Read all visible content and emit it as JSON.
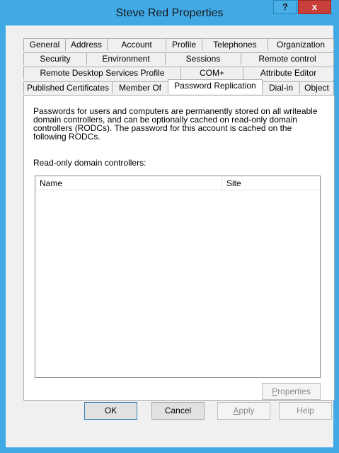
{
  "window": {
    "title": "Steve Red Properties"
  },
  "titlebar": {
    "help_glyph": "?",
    "close_glyph": "x"
  },
  "tabs": {
    "row1": [
      "General",
      "Address",
      "Account",
      "Profile",
      "Telephones",
      "Organization"
    ],
    "row2": [
      "Security",
      "Environment",
      "Sessions",
      "Remote control"
    ],
    "row3": [
      "Remote Desktop Services Profile",
      "COM+",
      "Attribute Editor"
    ],
    "row4": [
      "Published Certificates",
      "Member Of",
      "Password Replication",
      "Dial-in",
      "Object"
    ],
    "active": "Password Replication"
  },
  "panel": {
    "description": "Passwords for users and computers are permanently stored on all writeable domain controllers, and can be optionally cached on read-only domain controllers (RODCs). The password for this account is cached on the following RODCs.",
    "rodc_label": "Read-only domain controllers:",
    "columns": [
      "Name",
      "Site"
    ],
    "rows": [],
    "properties_prefix": "",
    "properties_mnemonic": "P",
    "properties_rest": "roperties"
  },
  "buttons": {
    "ok": "OK",
    "cancel": "Cancel",
    "apply_mnemonic": "A",
    "apply_rest": "pply",
    "help": "Help"
  }
}
